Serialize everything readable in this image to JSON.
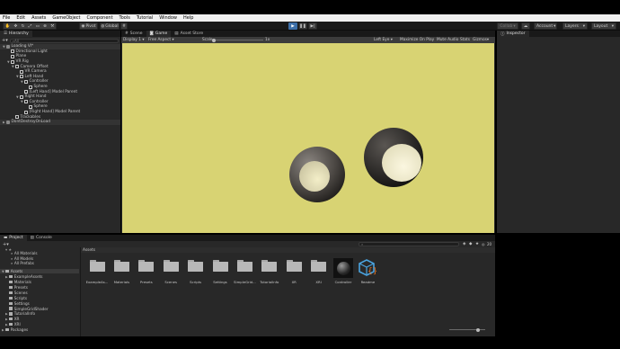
{
  "menu": [
    "File",
    "Edit",
    "Assets",
    "GameObject",
    "Component",
    "Tools",
    "Tutorial",
    "Window",
    "Help"
  ],
  "toolbar": {
    "pivot": "Pivot",
    "global": "Global",
    "collab": "Collab",
    "account": "Account",
    "layers": "Layers",
    "layout": "Layout"
  },
  "hierarchy": {
    "tab": "Hierarchy",
    "search_placeholder": "All",
    "rows": [
      {
        "label": "Loading VI*",
        "indent": 0,
        "arrow": "▼",
        "icon": "unity-scene-icon"
      },
      {
        "label": "Directional Light",
        "indent": 1,
        "arrow": "",
        "icon": "gameobject-icon"
      },
      {
        "label": "Plane",
        "indent": 1,
        "arrow": "",
        "icon": "gameobject-icon"
      },
      {
        "label": "VR Rig",
        "indent": 1,
        "arrow": "▼",
        "icon": "gameobject-icon"
      },
      {
        "label": "Camera Offset",
        "indent": 2,
        "arrow": "▼",
        "icon": "gameobject-icon"
      },
      {
        "label": "VR Camera",
        "indent": 3,
        "arrow": "",
        "icon": "gameobject-icon"
      },
      {
        "label": "Left Hand",
        "indent": 3,
        "arrow": "▼",
        "icon": "gameobject-icon"
      },
      {
        "label": "Controller",
        "indent": 4,
        "arrow": "▼",
        "icon": "gameobject-icon"
      },
      {
        "label": "Sphere",
        "indent": 5,
        "arrow": "",
        "icon": "gameobject-icon"
      },
      {
        "label": "[Left Hand] Model Parent",
        "indent": 4,
        "arrow": "",
        "icon": "gameobject-icon"
      },
      {
        "label": "Right Hand",
        "indent": 3,
        "arrow": "▼",
        "icon": "gameobject-icon"
      },
      {
        "label": "Controller",
        "indent": 4,
        "arrow": "▼",
        "icon": "gameobject-icon"
      },
      {
        "label": "Sphere",
        "indent": 5,
        "arrow": "",
        "icon": "gameobject-icon"
      },
      {
        "label": "[Right Hand] Model Parent",
        "indent": 4,
        "arrow": "",
        "icon": "gameobject-icon"
      },
      {
        "label": "Trackables",
        "indent": 2,
        "arrow": "",
        "icon": "gameobject-icon"
      },
      {
        "label": "DontDestroyOnLoad",
        "indent": 0,
        "arrow": "▶",
        "icon": "unity-scene-icon"
      }
    ]
  },
  "center_tabs": [
    "Scene",
    "Game",
    "Asset Store"
  ],
  "game_bar": {
    "display": "Display 1",
    "aspect": "Free Aspect",
    "scale_label": "Scale",
    "scale_value": "1x",
    "eye": "Left Eye",
    "maximize": "Maximize On Play",
    "mute": "Mute Audio",
    "stats": "Stats",
    "gizmos": "Gizmos"
  },
  "colors": {
    "game_bg": "#d8d373",
    "accent_play": "#3d6fa8",
    "panel": "#282828",
    "header": "#191919"
  },
  "inspector": {
    "tab": "Inspector"
  },
  "bottom_tabs": [
    "Project",
    "Console"
  ],
  "project_tree": {
    "favorites": [
      "All Materials",
      "All Models",
      "All Prefabs"
    ],
    "assets_root": "Assets",
    "folders": [
      "ExampleAssets",
      "Materials",
      "Presets",
      "Scenes",
      "Scripts",
      "Settings",
      "SimpleGridShader",
      "TutorialInfo",
      "XR",
      "XRI"
    ],
    "packages": "Packages"
  },
  "assets_panel": {
    "breadcrumb": "Assets",
    "hidden_count": "20",
    "items": [
      {
        "label": "ExampleAs...",
        "kind": "folder"
      },
      {
        "label": "Materials",
        "kind": "folder"
      },
      {
        "label": "Presets",
        "kind": "folder"
      },
      {
        "label": "Scenes",
        "kind": "folder"
      },
      {
        "label": "Scripts",
        "kind": "folder"
      },
      {
        "label": "Settings",
        "kind": "folder"
      },
      {
        "label": "SimpleGrid...",
        "kind": "folder"
      },
      {
        "label": "TutorialInfo",
        "kind": "folder"
      },
      {
        "label": "XR",
        "kind": "folder"
      },
      {
        "label": "XRI",
        "kind": "folder"
      },
      {
        "label": "Controller",
        "kind": "material"
      },
      {
        "label": "Readme",
        "kind": "script-asset"
      }
    ]
  }
}
